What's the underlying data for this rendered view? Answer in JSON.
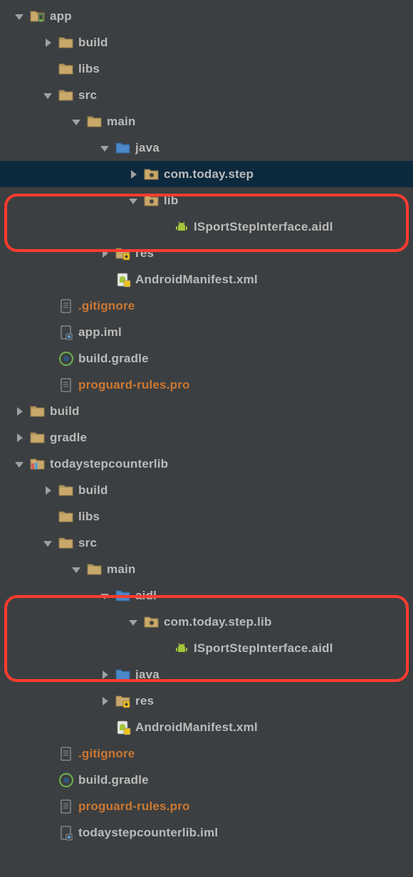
{
  "tree": {
    "app": {
      "label": "app",
      "build": "build",
      "libs": "libs",
      "src": "src",
      "main": "main",
      "java": "java",
      "pkg": "com.today.step",
      "lib": "lib",
      "aidl_file": "ISportStepInterface.aidl",
      "res": "res",
      "manifest": "AndroidManifest.xml",
      "gitignore": ".gitignore",
      "app_iml": "app.iml",
      "build_gradle": "build.gradle",
      "proguard": "proguard-rules.pro"
    },
    "root_build": "build",
    "root_gradle": "gradle",
    "lib_module": {
      "label": "todaystepcounterlib",
      "build": "build",
      "libs": "libs",
      "src": "src",
      "main": "main",
      "aidl": "aidl",
      "pkg": "com.today.step.lib",
      "aidl_file": "ISportStepInterface.aidl",
      "java": "java",
      "res": "res",
      "manifest": "AndroidManifest.xml",
      "gitignore": ".gitignore",
      "build_gradle": "build.gradle",
      "proguard": "proguard-rules.pro",
      "iml": "todaystepcounterlib.iml"
    }
  }
}
